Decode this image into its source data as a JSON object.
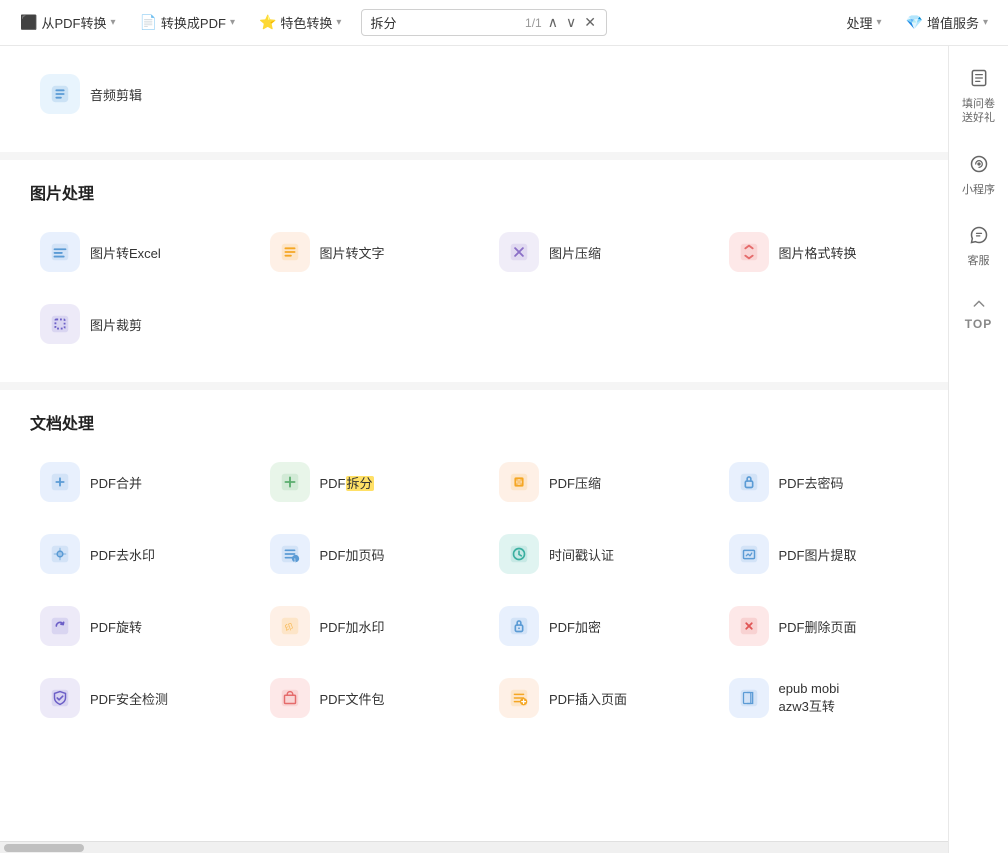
{
  "toolbar": {
    "items": [
      {
        "id": "from-pdf",
        "label": "从PDF转换",
        "hasChevron": true
      },
      {
        "id": "to-pdf",
        "label": "转换成PDF",
        "hasChevron": true
      },
      {
        "id": "special-convert",
        "label": "特色转换",
        "hasChevron": true
      },
      {
        "id": "doc-process",
        "label": "处理",
        "hasChevron": true
      },
      {
        "id": "value-service",
        "label": "增值服务",
        "hasChevron": true
      }
    ],
    "search": {
      "value": "拆分",
      "counter": "1/1"
    }
  },
  "sections": [
    {
      "id": "audio",
      "tools": [
        {
          "id": "audio-cut",
          "name": "音频剪辑",
          "iconColor": "blue-light",
          "iconSymbol": "✂️"
        }
      ]
    },
    {
      "id": "image-processing",
      "title": "图片处理",
      "tools": [
        {
          "id": "img-to-excel",
          "name": "图片转Excel",
          "iconColor": "blue-light",
          "iconSymbol": "📊"
        },
        {
          "id": "img-to-text",
          "name": "图片转文字",
          "iconColor": "orange",
          "iconSymbol": "🔤"
        },
        {
          "id": "img-compress",
          "name": "图片压缩",
          "iconColor": "purple",
          "iconSymbol": "🗜"
        },
        {
          "id": "img-format",
          "name": "图片格式转换",
          "iconColor": "pink",
          "iconSymbol": "🔄"
        },
        {
          "id": "img-crop",
          "name": "图片裁剪",
          "iconColor": "indigo",
          "iconSymbol": "✂"
        }
      ]
    },
    {
      "id": "doc-processing",
      "title": "文档处理",
      "tools": [
        {
          "id": "pdf-merge",
          "name": "PDF合并",
          "iconColor": "blue-light",
          "iconSymbol": "🔗"
        },
        {
          "id": "pdf-split",
          "name": "PDF拆分",
          "iconColor": "green",
          "iconSymbol": "✂",
          "highlight": "拆分"
        },
        {
          "id": "pdf-compress",
          "name": "PDF压缩",
          "iconColor": "orange",
          "iconSymbol": "🗜"
        },
        {
          "id": "pdf-decrypt",
          "name": "PDF去密码",
          "iconColor": "blue-light",
          "iconSymbol": "🔓"
        },
        {
          "id": "pdf-watermark-remove",
          "name": "PDF去水印",
          "iconColor": "blue-light",
          "iconSymbol": "💧"
        },
        {
          "id": "pdf-page-num",
          "name": "PDF加页码",
          "iconColor": "blue-light",
          "iconSymbol": "🔢"
        },
        {
          "id": "timestamp",
          "name": "时间戳认证",
          "iconColor": "teal",
          "iconSymbol": "⏰"
        },
        {
          "id": "pdf-img-extract",
          "name": "PDF图片提取",
          "iconColor": "blue-light",
          "iconSymbol": "🖼"
        },
        {
          "id": "pdf-rotate",
          "name": "PDF旋转",
          "iconColor": "indigo",
          "iconSymbol": "🔃"
        },
        {
          "id": "pdf-watermark-add",
          "name": "PDF加水印",
          "iconColor": "orange",
          "iconSymbol": "💧"
        },
        {
          "id": "pdf-encrypt",
          "name": "PDF加密",
          "iconColor": "blue-light",
          "iconSymbol": "🔒"
        },
        {
          "id": "pdf-delete-page",
          "name": "PDF删除页面",
          "iconColor": "red",
          "iconSymbol": "🗑"
        },
        {
          "id": "pdf-security",
          "name": "PDF安全检测",
          "iconColor": "indigo",
          "iconSymbol": "🛡"
        },
        {
          "id": "pdf-package",
          "name": "PDF文件包",
          "iconColor": "pink",
          "iconSymbol": "📦"
        },
        {
          "id": "pdf-insert-page",
          "name": "PDF插入页面",
          "iconColor": "orange",
          "iconSymbol": "📄"
        },
        {
          "id": "epub-mobi",
          "name": "epub mobi\nazw3互转",
          "iconColor": "blue-light",
          "iconSymbol": "📚"
        }
      ]
    }
  ],
  "rightPanel": {
    "items": [
      {
        "id": "survey",
        "icon": "📋",
        "label": "填问卷\n送好礼"
      },
      {
        "id": "miniapp",
        "icon": "⚙️",
        "label": "小程序"
      },
      {
        "id": "service",
        "icon": "💬",
        "label": "客服"
      }
    ],
    "topBtn": {
      "label": "TOP"
    }
  },
  "colors": {
    "highlight": "#ffe066",
    "accent": "#4a90d9"
  }
}
